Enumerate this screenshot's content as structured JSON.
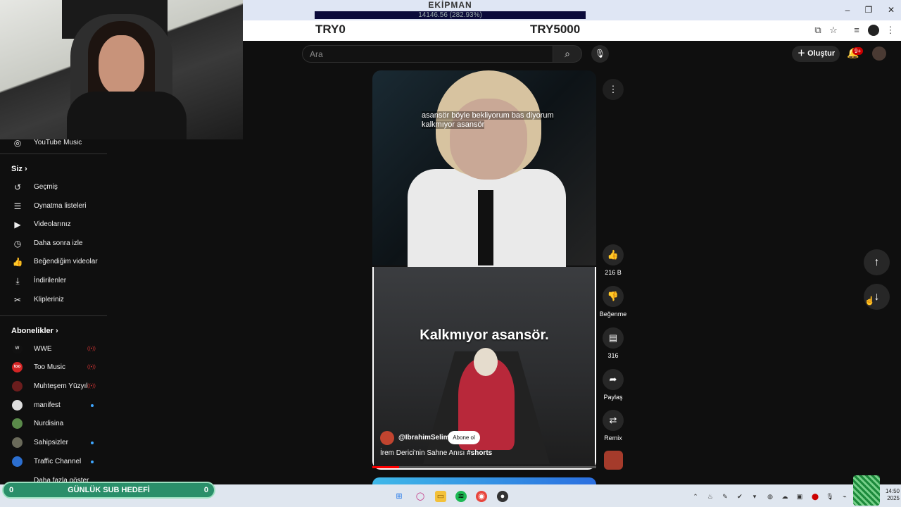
{
  "overlay": {
    "ekipman_label": "EKİPMAN",
    "ekipman_amount": "14146.56 (282.93%)",
    "goal_start": "TRY0",
    "goal_end": "TRY5000"
  },
  "window_controls": {
    "minimize": "–",
    "restore": "❐",
    "close": "✕"
  },
  "header": {
    "search_placeholder": "Ara",
    "create_label": "Oluştur",
    "notifications_badge": "9+"
  },
  "sidebar": {
    "partial_item": "YouTube Music",
    "you_section": "Siz",
    "you_items": [
      {
        "label": "Geçmiş",
        "icon": "history-icon"
      },
      {
        "label": "Oynatma listeleri",
        "icon": "playlists-icon"
      },
      {
        "label": "Videolarınız",
        "icon": "your-videos-icon"
      },
      {
        "label": "Daha sonra izle",
        "icon": "watch-later-icon"
      },
      {
        "label": "Beğendiğim videolar",
        "icon": "liked-videos-icon"
      },
      {
        "label": "İndirilenler",
        "icon": "downloads-icon"
      },
      {
        "label": "Klipleriniz",
        "icon": "clips-icon"
      }
    ],
    "subs_section": "Abonelikler",
    "subscriptions": [
      {
        "name": "WWE",
        "status": "live"
      },
      {
        "name": "Too Music",
        "status": "live"
      },
      {
        "name": "Muhteşem Yüzyıl",
        "status": "live"
      },
      {
        "name": "manifest",
        "status": "new"
      },
      {
        "name": "Nurdisina",
        "status": ""
      },
      {
        "name": "Sahipsizler",
        "status": "new"
      },
      {
        "name": "Traffic Channel",
        "status": "new"
      }
    ],
    "show_more": "Daha fazla göster"
  },
  "short": {
    "caption_line1": "asansör böyle bekliyorum bas diyorum",
    "caption_line2": "kalkmıyor asansör",
    "overlay_text": "Kalkmıyor asansör.",
    "channel": "@IbrahimSelim",
    "subscribe_label": "Abone ol",
    "title": "İrem Derici'nin Sahne Anısı",
    "hashtag": "#shorts",
    "progress": 0.12
  },
  "actions": {
    "likes": "216 B",
    "dislike_label": "Beğenme",
    "comments": "316",
    "share_label": "Paylaş",
    "remix_label": "Remix"
  },
  "stream_widget": {
    "left_count": "0",
    "label": "GÜNLÜK SUB HEDEFİ",
    "right_count": "0"
  },
  "clock": {
    "time": "14:50",
    "year": "2025"
  }
}
